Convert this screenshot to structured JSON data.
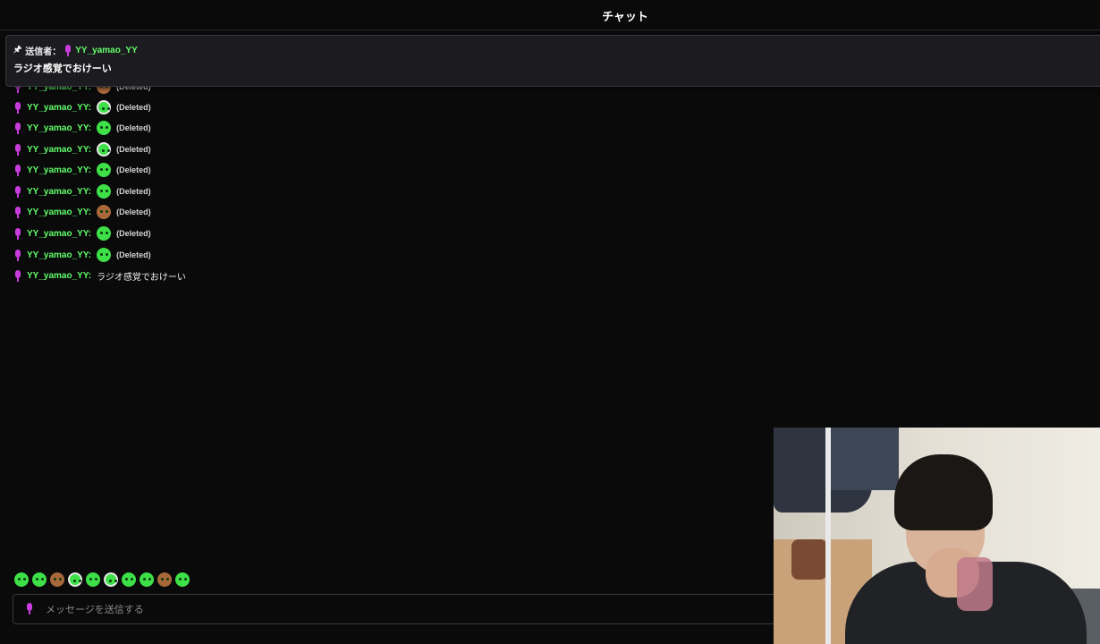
{
  "header": {
    "title": "チャット"
  },
  "pinned": {
    "sender_label": "送信者：",
    "user": "YY_yamao_YY",
    "message": "ラジオ感覚でおけーい"
  },
  "chat": {
    "messages": [
      {
        "user": "YY_yamao_YY:",
        "emote": "green-blob-emote",
        "text": "(Deleted)"
      },
      {
        "user": "YY_yamao_YY:",
        "emote": "green-blob-emote",
        "text": "(Deleted)"
      },
      {
        "user": "YY_yamao_YY:",
        "emote": "green-blob-emote",
        "text": "(Deleted)"
      },
      {
        "user": "YY_yamao_YY:",
        "emote": "green-blob-emote",
        "text": "(Deleted)"
      },
      {
        "user": "YY_yamao_YY:",
        "emote": "green-blob-emote",
        "text": "(Deleted)"
      },
      {
        "user": "YY_yamao_YY:",
        "emote": "green-blob-emote",
        "text": "(Deleted)"
      },
      {
        "user": "YY_yamao_YY:",
        "emote": "brown-emote",
        "text": "(Deleted)"
      },
      {
        "user": "YY_yamao_YY:",
        "emote": "green-blob-emote",
        "text": "(Deleted)"
      },
      {
        "user": "YY_yamao_YY:",
        "emote": "green-blob-emote",
        "text": "(Deleted)"
      },
      {
        "user": "YY_yamao_YY:",
        "emote": null,
        "text": "ラジオ感覚でおけーい"
      }
    ]
  },
  "input": {
    "placeholder": "メッセージを送信する"
  },
  "colors": {
    "username": "#62ff6a",
    "mic": "#c83cdc",
    "background": "#0a0a0b"
  }
}
